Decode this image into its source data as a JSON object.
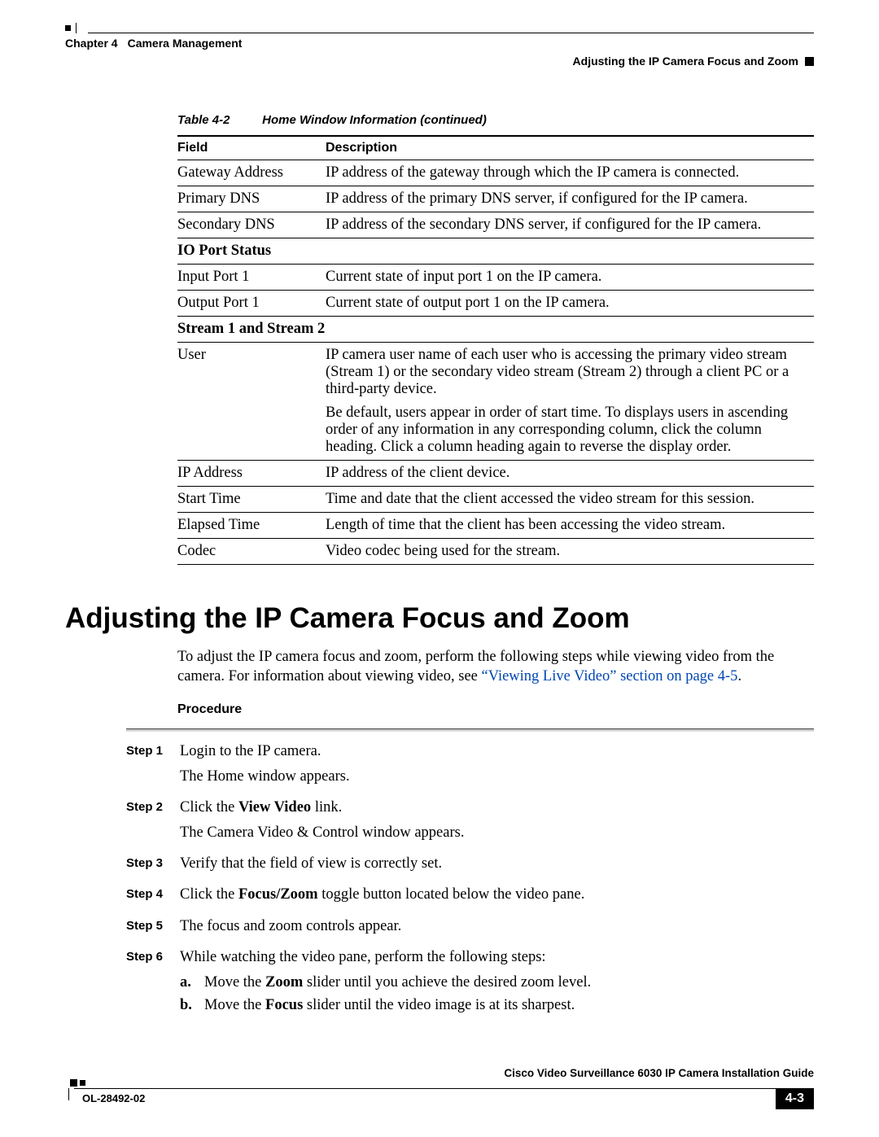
{
  "header": {
    "chapter_label": "Chapter 4",
    "chapter_title": "Camera Management",
    "section_title": "Adjusting the IP Camera Focus and Zoom"
  },
  "table": {
    "caption_number": "Table 4-2",
    "caption_title": "Home Window Information (continued)",
    "col_field": "Field",
    "col_desc": "Description",
    "rows": [
      {
        "field": "Gateway Address",
        "desc": "IP address of the gateway through which the IP camera is connected."
      },
      {
        "field": "Primary DNS",
        "desc": "IP address of the primary DNS server, if configured for the IP camera."
      },
      {
        "field": "Secondary DNS",
        "desc": "IP address of the secondary DNS server, if configured for the IP camera."
      }
    ],
    "section_io": "IO Port Status",
    "rows_io": [
      {
        "field": "Input Port 1",
        "desc": "Current state of input port 1 on the IP camera."
      },
      {
        "field": "Output Port 1",
        "desc": "Current state of output port 1 on the IP camera."
      }
    ],
    "section_stream": "Stream 1 and Stream 2",
    "row_user_field": "User",
    "row_user_p1": "IP camera user name of each user who is accessing the primary video stream (Stream 1) or the secondary video stream (Stream 2) through a client PC or a third-party device.",
    "row_user_p2": "Be default, users appear in order of start time. To displays users in ascending order of any information in any corresponding column, click the column heading. Click a column heading again to reverse the display order.",
    "rows_stream": [
      {
        "field": "IP Address",
        "desc": "IP address of the client device."
      },
      {
        "field": "Start Time",
        "desc": "Time and date that the client accessed the video stream for this session."
      },
      {
        "field": "Elapsed Time",
        "desc": "Length of time that the client has been accessing the video stream."
      },
      {
        "field": "Codec",
        "desc": "Video codec being used for the stream."
      }
    ]
  },
  "heading": "Adjusting the IP Camera Focus and Zoom",
  "intro_pre": "To adjust the IP camera focus and zoom, perform the following steps while viewing video from the camera. For information about viewing video, see ",
  "intro_link": "“Viewing Live Video” section on page 4-5",
  "intro_post": ".",
  "procedure_label": "Procedure",
  "steps": {
    "s1a": "Login to the IP camera.",
    "s1b": "The Home window appears.",
    "s2a_pre": "Click the ",
    "s2a_b": "View Video",
    "s2a_post": " link.",
    "s2b": "The Camera Video & Control window appears.",
    "s3": "Verify that the field of view is correctly set.",
    "s4_pre": "Click the ",
    "s4_b": "Focus/Zoom",
    "s4_post": " toggle button located below the video pane.",
    "s5": "The focus and zoom controls appear.",
    "s6": "While watching the video pane, perform the following steps:",
    "s6a_pre": "Move the ",
    "s6a_b": "Zoom",
    "s6a_post": " slider until you achieve the desired zoom level.",
    "s6b_pre": "Move the ",
    "s6b_b": "Focus",
    "s6b_post": " slider until the video image is at its sharpest.",
    "labels": {
      "s1": "Step 1",
      "s2": "Step 2",
      "s3": "Step 3",
      "s4": "Step 4",
      "s5": "Step 5",
      "s6": "Step 6",
      "a": "a.",
      "b": "b."
    }
  },
  "footer": {
    "guide": "Cisco Video Surveillance 6030 IP Camera Installation Guide",
    "docid": "OL-28492-02",
    "page": "4-3"
  }
}
